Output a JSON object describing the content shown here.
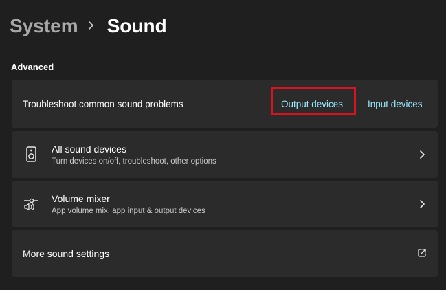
{
  "breadcrumb": {
    "parent": "System",
    "current": "Sound"
  },
  "advanced": {
    "title": "Advanced",
    "troubleshoot": {
      "label": "Troubleshoot common sound problems",
      "output_link": "Output devices",
      "input_link": "Input devices"
    },
    "all_devices": {
      "title": "All sound devices",
      "subtitle": "Turn devices on/off, troubleshoot, other options",
      "icon": "speaker-icon"
    },
    "volume_mixer": {
      "title": "Volume mixer",
      "subtitle": "App volume mix, app input & output devices",
      "icon": "volume-mixer-icon"
    },
    "more_settings": {
      "title": "More sound settings",
      "icon": "open-external-icon"
    }
  },
  "colors": {
    "background": "#1f1f1f",
    "card": "#2b2b2b",
    "link": "#99ebff",
    "highlight": "#d9121f"
  }
}
